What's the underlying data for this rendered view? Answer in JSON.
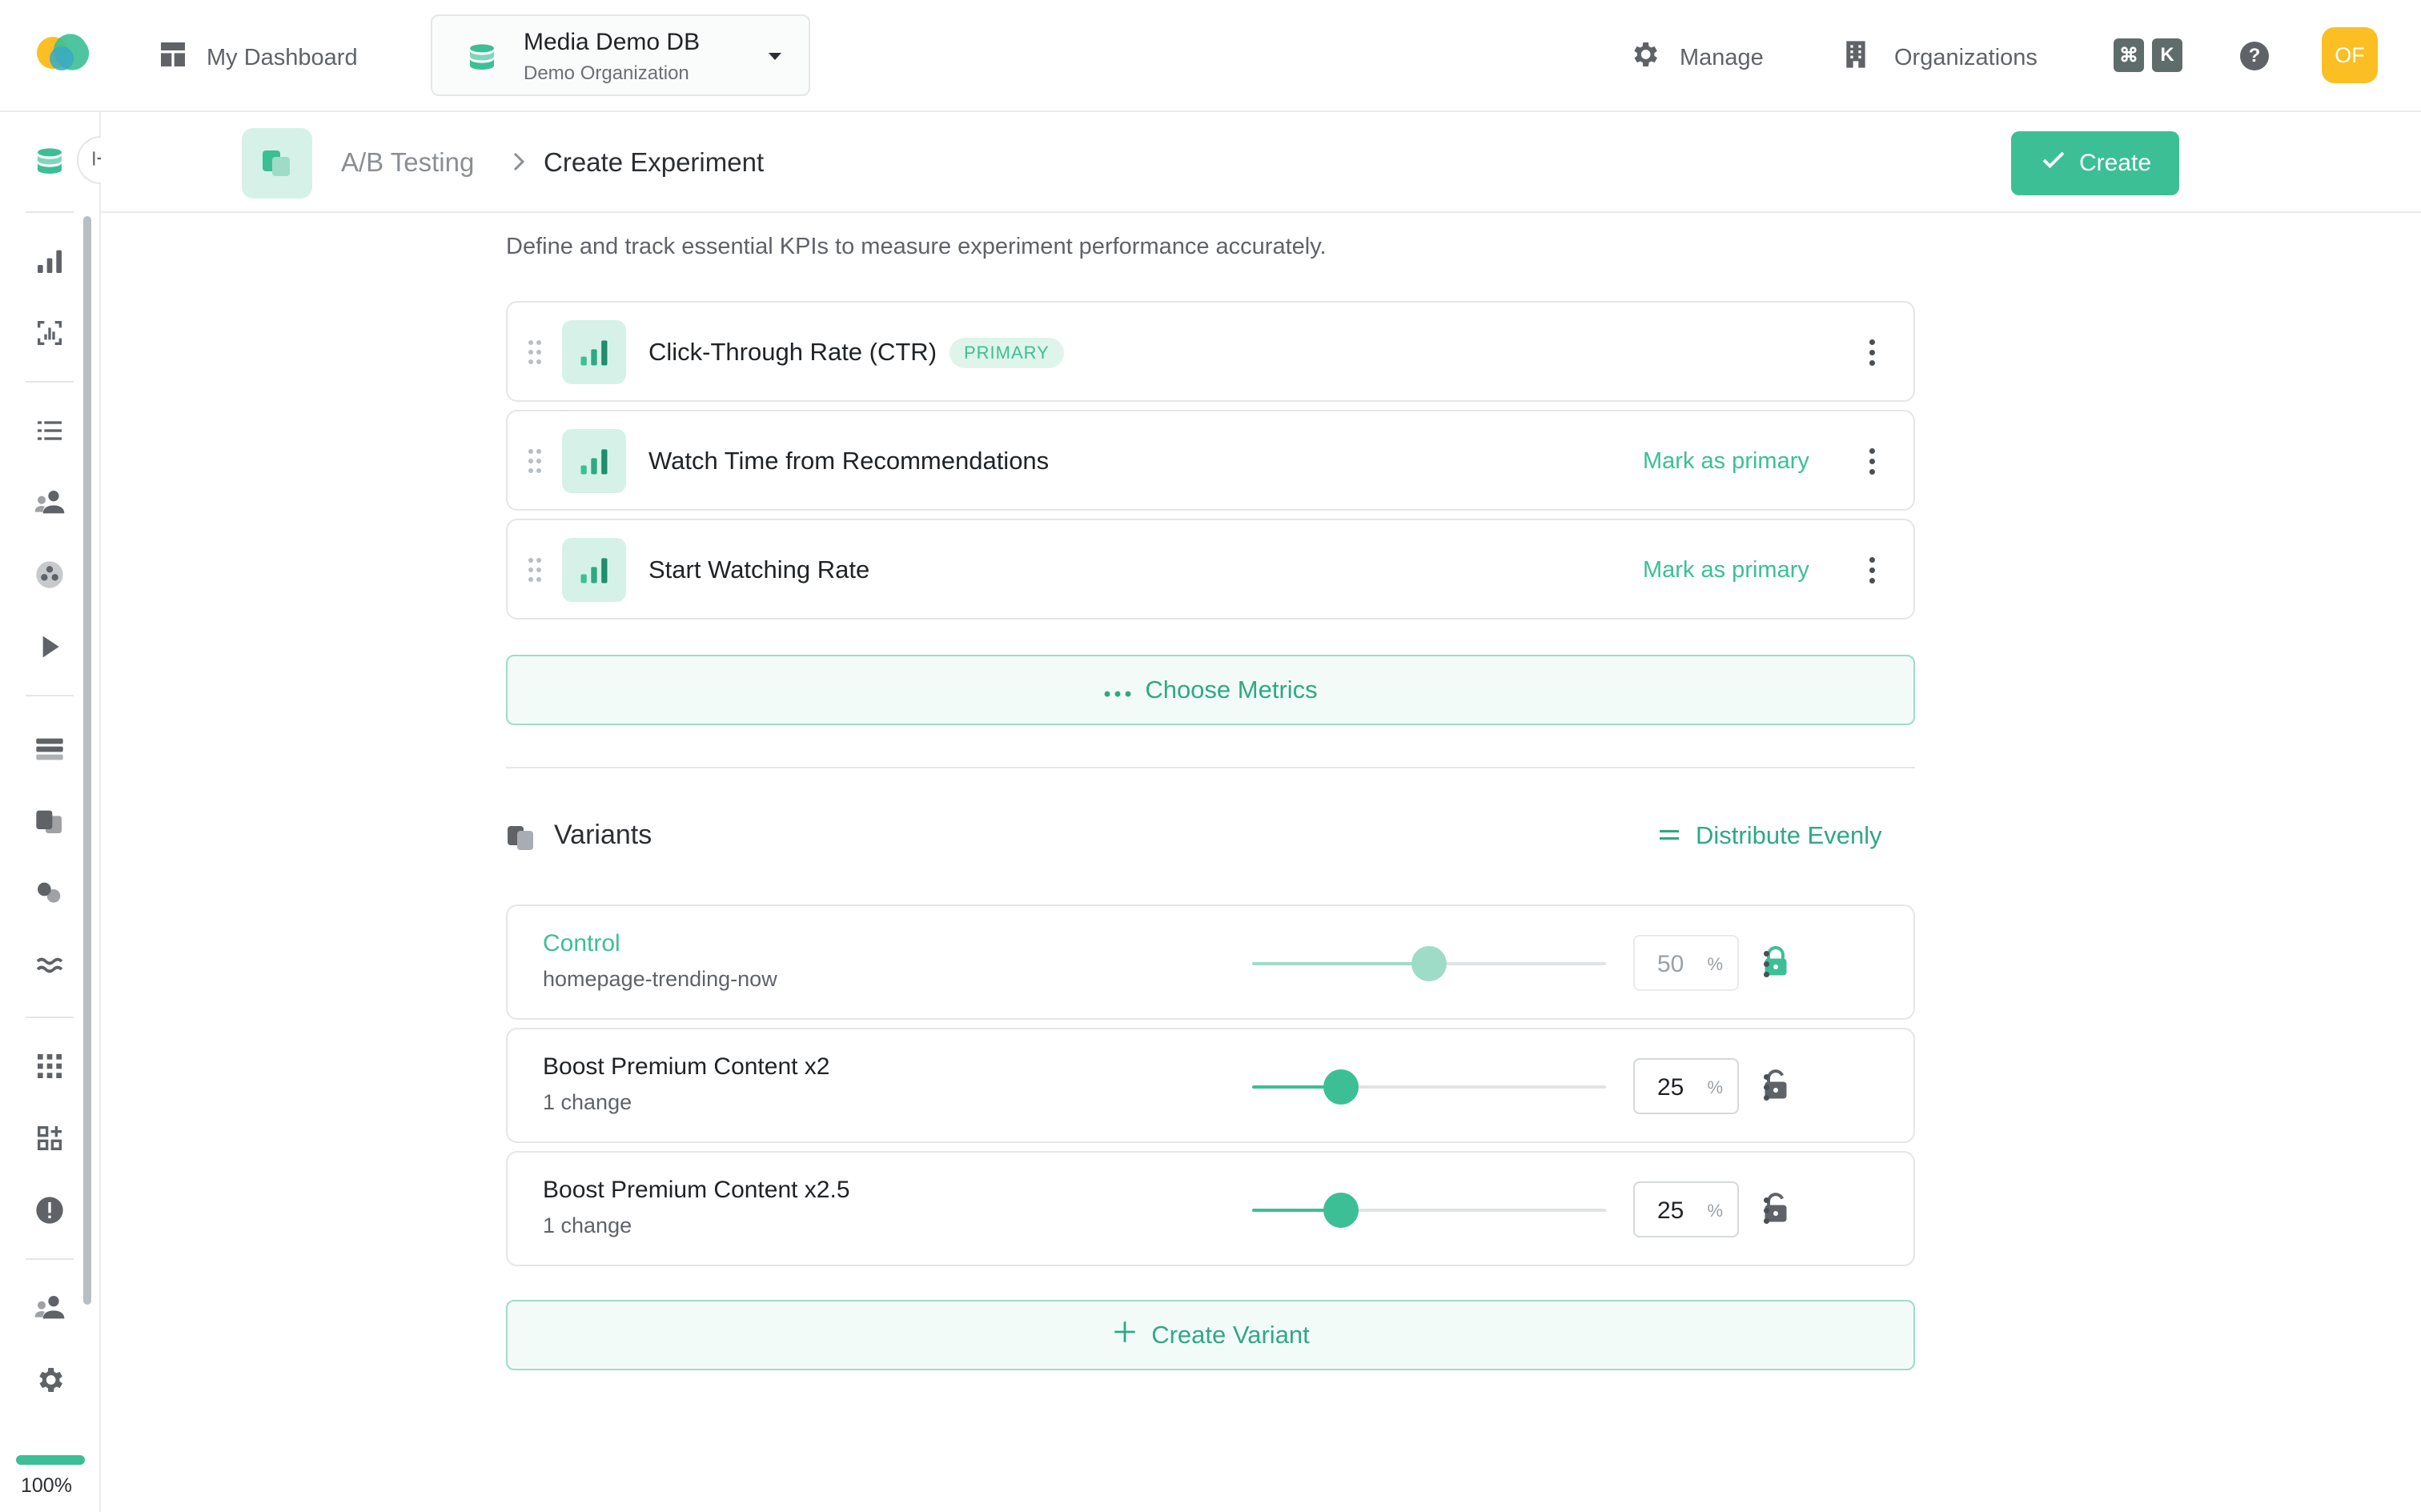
{
  "topbar": {
    "dashboard_label": "My Dashboard",
    "db_name": "Media Demo DB",
    "db_org": "Demo Organization",
    "manage_label": "Manage",
    "organizations_label": "Organizations",
    "shortcut_keys": [
      "⌘",
      "K"
    ],
    "help_label": "?",
    "avatar_initials": "OF"
  },
  "breadcrumb": {
    "parent": "A/B Testing",
    "separator": ">",
    "current": "Create Experiment"
  },
  "actions": {
    "create_label": "Create"
  },
  "metrics": {
    "description": "Define and track essential KPIs to measure experiment performance accurately.",
    "items": [
      {
        "name": "Click-Through Rate (CTR)",
        "badge": "PRIMARY",
        "action": ""
      },
      {
        "name": "Watch Time from Recommendations",
        "badge": "",
        "action": "Mark as primary"
      },
      {
        "name": "Start Watching Rate",
        "badge": "",
        "action": "Mark as primary"
      }
    ],
    "choose_label": "Choose Metrics"
  },
  "variants": {
    "title": "Variants",
    "distribute_label": "Distribute Evenly",
    "items": [
      {
        "name": "Control",
        "subtitle": "homepage-trending-now",
        "percent": "50",
        "unit": "%",
        "slider_value": 0.5,
        "locked": true
      },
      {
        "name": "Boost Premium Content x2",
        "subtitle": "1 change",
        "percent": "25",
        "unit": "%",
        "slider_value": 0.25,
        "locked": false
      },
      {
        "name": "Boost Premium Content x2.5",
        "subtitle": "1 change",
        "percent": "25",
        "unit": "%",
        "slider_value": 0.25,
        "locked": false
      }
    ],
    "create_variant_label": "Create Variant"
  },
  "sidebar": {
    "progress_value": 1.0,
    "progress_text": "100%"
  },
  "colors": {
    "accent": "#3cbf95",
    "accent_light": "#d6f2e8",
    "avatar": "#fbbf24"
  }
}
